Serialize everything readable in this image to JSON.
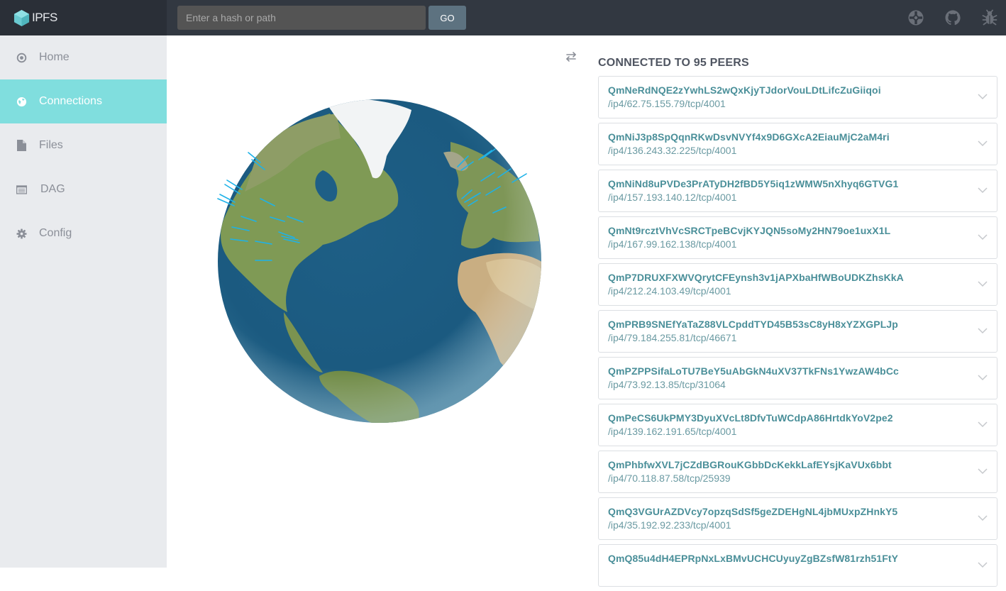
{
  "app": {
    "brand": "IPFS",
    "brand_color": "#6acad1",
    "accent_color": "#80dede"
  },
  "topbar": {
    "search_placeholder": "Enter a hash or path",
    "search_value": "",
    "go_label": "GO",
    "icons": [
      "help-lifebuoy-icon",
      "github-icon",
      "bug-icon"
    ]
  },
  "sidebar": {
    "items": [
      {
        "label": "Home",
        "icon": "target-icon",
        "active": false
      },
      {
        "label": "Connections",
        "icon": "globe-icon",
        "active": true
      },
      {
        "label": "Files",
        "icon": "file-icon",
        "active": false
      },
      {
        "label": "DAG",
        "icon": "list-icon",
        "active": false
      },
      {
        "label": "Config",
        "icon": "gear-icon",
        "active": false
      }
    ]
  },
  "connections": {
    "title": "CONNECTED TO 95 PEERS",
    "peer_count": 95,
    "peers": [
      {
        "id": "QmNeRdNQE2zYwhLS2wQxKjyTJdorVouLDtLifcZuGiiqoi",
        "address": "/ip4/62.75.155.79/tcp/4001"
      },
      {
        "id": "QmNiJ3p8SpQqnRKwDsvNVYf4x9D6GXcA2EiauMjC2aM4ri",
        "address": "/ip4/136.243.32.225/tcp/4001"
      },
      {
        "id": "QmNiNd8uPVDe3PrATyDH2fBD5Y5iq1zWMW5nXhyq6GTVG1",
        "address": "/ip4/157.193.140.12/tcp/4001"
      },
      {
        "id": "QmNt9rcztVhVcSRCTpeBCvjKYJQN5soMy2HN79oe1uxX1L",
        "address": "/ip4/167.99.162.138/tcp/4001"
      },
      {
        "id": "QmP7DRUXFXWVQrytCFEynsh3v1jAPXbaHfWBoUDKZhsKkA",
        "address": "/ip4/212.24.103.49/tcp/4001"
      },
      {
        "id": "QmPRB9SNEfYaTaZ88VLCpddTYD45B53sC8yH8xYZXGPLJp",
        "address": "/ip4/79.184.255.81/tcp/46671"
      },
      {
        "id": "QmPZPPSifaLoTU7BeY5uAbGkN4uXV37TkFNs1YwzAW4bCc",
        "address": "/ip4/73.92.13.85/tcp/31064"
      },
      {
        "id": "QmPeCS6UkPMY3DyuXVcLt8DfvTuWCdpA86HrtdkYoV2pe2",
        "address": "/ip4/139.162.191.65/tcp/4001"
      },
      {
        "id": "QmPhbfwXVL7jCZdBGRouKGbbDcKekkLafEYsjKaVUx6bbt",
        "address": "/ip4/70.118.87.58/tcp/25939"
      },
      {
        "id": "QmQ3VGUrAZDVcy7opzqSdSf5geZDEHgNL4jbMUxpZHnkY5",
        "address": "/ip4/35.192.92.233/tcp/4001"
      },
      {
        "id": "QmQ85u4dH4EPRpNxLxBMvUCHCUyuyZgBZsfW81rzh51FtY",
        "address": ""
      }
    ]
  }
}
